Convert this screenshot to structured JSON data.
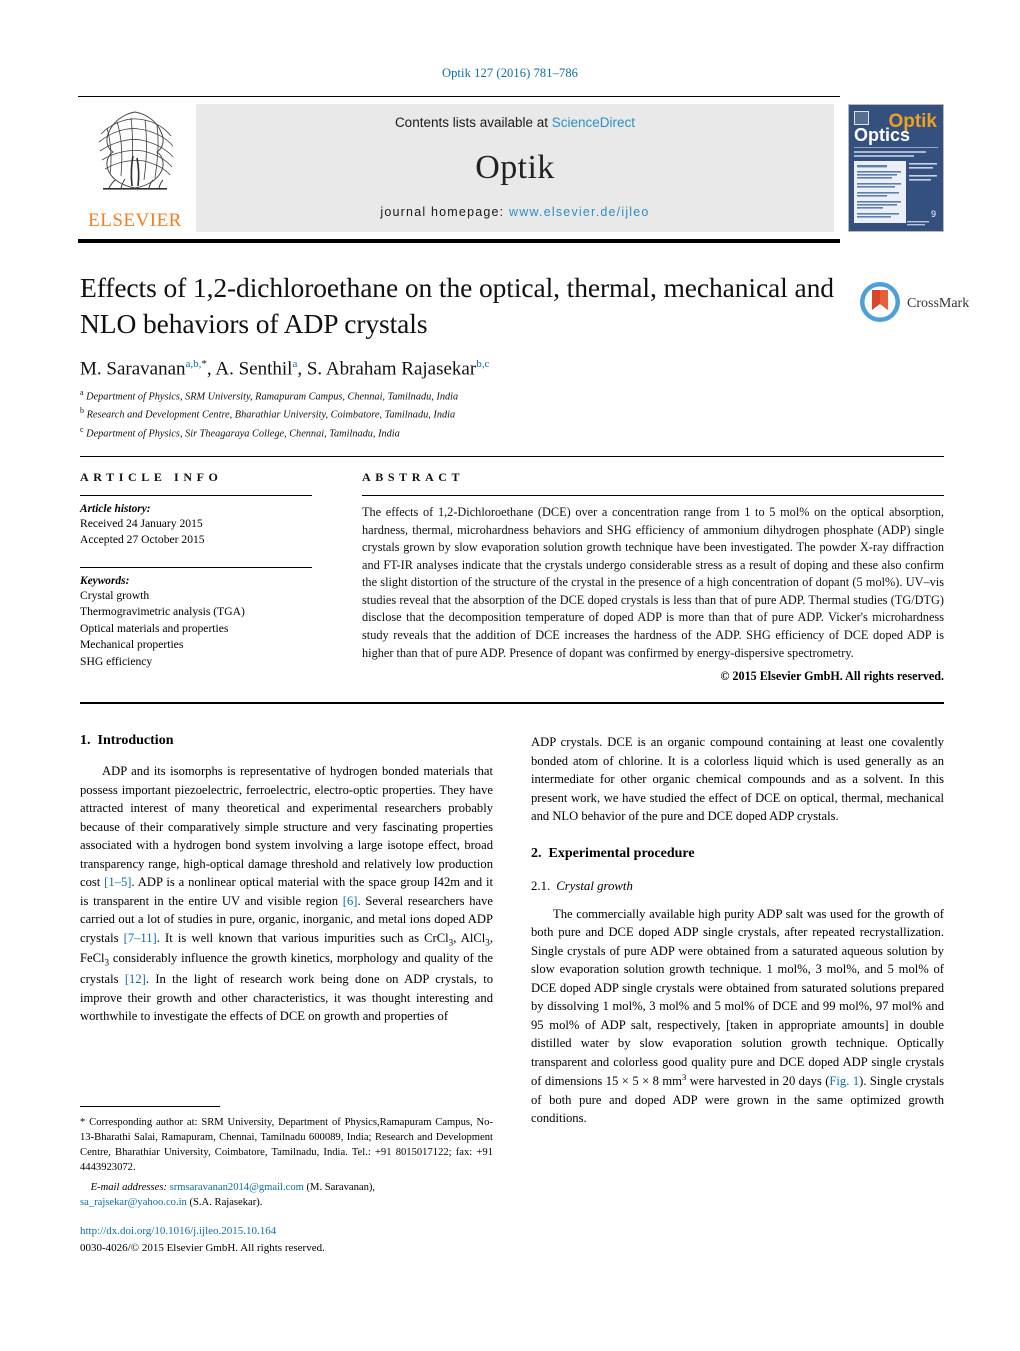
{
  "running_head": "Optik 127 (2016) 781–786",
  "masthead": {
    "contents_prefix": "Contents lists available at ",
    "contents_link": "ScienceDirect",
    "journal_title": "Optik",
    "homepage_label": "journal homepage:",
    "homepage_url": "www.elsevier.de/ijleo",
    "publisher": "ELSEVIER",
    "cover_title_top": "Optik",
    "cover_title_bottom": "Optics",
    "link_color": "#2b8fc4"
  },
  "article": {
    "title": "Effects of 1,2-dichloroethane on the optical, thermal, mechanical and NLO behaviors of ADP crystals",
    "authors": [
      {
        "name": "M. Saravanan",
        "marks": "a,b,",
        "star": "*"
      },
      {
        "name": "A. Senthil",
        "marks": "a",
        "star": ""
      },
      {
        "name": "S. Abraham Rajasekar",
        "marks": "b,c",
        "star": ""
      }
    ],
    "affiliations": [
      {
        "mark": "a",
        "text": "Department of Physics, SRM University, Ramapuram Campus, Chennai, Tamilnadu, India"
      },
      {
        "mark": "b",
        "text": "Research and Development Centre, Bharathiar University, Coimbatore, Tamilnadu, India"
      },
      {
        "mark": "c",
        "text": "Department of Physics, Sir Theagaraya College, Chennai, Tamilnadu, India"
      }
    ],
    "crossmark_label": "CrossMark"
  },
  "article_info": {
    "heading": "ARTICLE INFO",
    "history_label": "Article history:",
    "received": "Received 24 January 2015",
    "accepted": "Accepted 27 October 2015",
    "keywords_label": "Keywords:",
    "keywords": [
      "Crystal growth",
      "Thermogravimetric analysis (TGA)",
      "Optical materials and properties",
      "Mechanical properties",
      "SHG efficiency"
    ]
  },
  "abstract": {
    "heading": "ABSTRACT",
    "text": "The effects of 1,2-Dichloroethane (DCE) over a concentration range from 1 to 5 mol% on the optical absorption, hardness, thermal, microhardness behaviors and SHG efficiency of ammonium dihydrogen phosphate (ADP) single crystals grown by slow evaporation solution growth technique have been investigated. The powder X-ray diffraction and FT-IR analyses indicate that the crystals undergo considerable stress as a result of doping and these also confirm the slight distortion of the structure of the crystal in the presence of a high concentration of dopant (5 mol%). UV–vis studies reveal that the absorption of the DCE doped crystals is less than that of pure ADP. Thermal studies (TG/DTG) disclose that the decomposition temperature of doped ADP is more than that of pure ADP. Vicker's microhardness study reveals that the addition of DCE increases the hardness of the ADP. SHG efficiency of DCE doped ADP is higher than that of pure ADP. Presence of dopant was confirmed by energy-dispersive spectrometry.",
    "copyright": "© 2015 Elsevier GmbH. All rights reserved."
  },
  "sections": {
    "introduction": {
      "number": "1.",
      "title": "Introduction",
      "para1_part1": "ADP and its isomorphs is representative of hydrogen bonded materials that possess important piezoelectric, ferroelectric, electro-optic properties. They have attracted interest of many theoretical and experimental researchers probably because of their comparatively simple structure and very fascinating properties associated with a hydrogen bond system involving a large isotope effect, broad transparency range, high-optical damage threshold and relatively low production cost ",
      "ref1": "[1–5]",
      "para1_part2": ". ADP is a nonlinear optical material with the space group I42m and it is transparent in the entire UV and visible region ",
      "ref2": "[6]",
      "para1_part3": ". Several researchers have carried out a lot of studies in pure, organic, inorganic, and metal ions doped ADP crystals ",
      "ref3": "[7–11]",
      "para1_part4": ". It is well known that various impurities such as CrCl3, AlCl3, FeCl3 considerably influence the growth kinetics, morphology and quality of the crystals ",
      "ref4": "[12]",
      "para1_part5": ". In the light of research work being done on ADP crystals, to improve their growth and other characteristics, it was thought interesting and worthwhile to investigate the effects of DCE on growth and properties of ADP crystals. DCE is an organic compound containing at least one covalently bonded atom of chlorine. It is a colorless liquid which is used generally as an intermediate for other organic chemical compounds and as a solvent. In this present work, we have studied the effect of DCE on optical, thermal, mechanical and NLO behavior of the pure and DCE doped ADP crystals."
    },
    "experimental": {
      "number": "2.",
      "title": "Experimental procedure",
      "sub_number": "2.1.",
      "sub_title": "Crystal growth",
      "para_part1": "The commercially available high purity ADP salt was used for the growth of both pure and DCE doped ADP single crystals, after repeated recrystallization. Single crystals of pure ADP were obtained from a saturated aqueous solution by slow evaporation solution growth technique. 1 mol%, 3 mol%, and 5 mol% of DCE doped ADP single crystals were obtained from saturated solutions prepared by dissolving 1 mol%, 3 mol% and 5 mol% of DCE and 99 mol%, 97 mol% and 95 mol% of ADP salt, respectively, [taken in appropriate amounts] in double distilled water by slow evaporation solution growth technique. Optically transparent and colorless good quality pure and DCE doped ADP single crystals of dimensions 15 × 5 × 8 mm",
      "para_sup": "3",
      "para_part2": " were harvested in 20 days (",
      "fig_ref": "Fig. 1",
      "para_part3": "). Single crystals of both pure and doped ADP were grown in the same optimized growth conditions."
    }
  },
  "footnote": {
    "star": "*",
    "corresponding": " Corresponding author at: SRM University, Department of Physics,Ramapuram Campus, No-13-Bharathi Salai, Ramapuram, Chennai, Tamilnadu 600089, India; Research and Development Centre, Bharathiar University, Coimbatore, Tamilnadu, India. Tel.: +91 8015017122; fax: +91 4443923072.",
    "email_label": "E-mail addresses:",
    "email1": "srmsaravanan2014@gmail.com",
    "email1_owner": "(M. Saravanan),",
    "email2": "sa_rajsekar@yahoo.co.in",
    "email2_owner": "(S.A. Rajasekar)."
  },
  "doi": {
    "url": "http://dx.doi.org/10.1016/j.ijleo.2015.10.164",
    "issn": "0030-4026/© 2015 Elsevier GmbH. All rights reserved."
  }
}
